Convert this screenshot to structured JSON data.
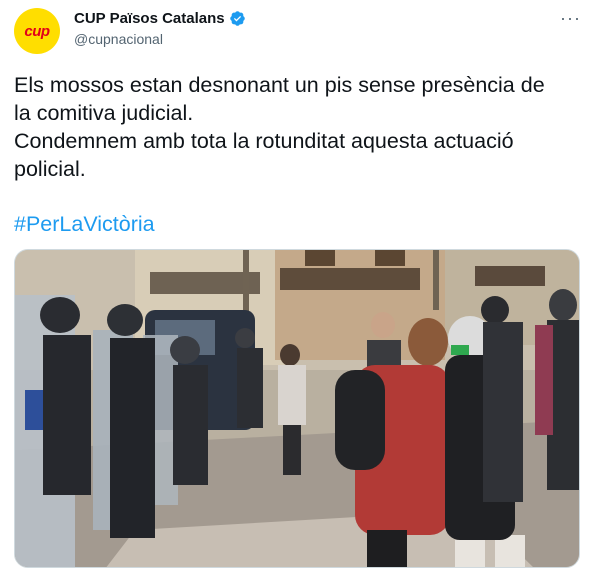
{
  "account": {
    "avatar_text": "cup",
    "display_name": "CUP Països Catalans",
    "handle": "@cupnacional",
    "verified": true,
    "avatar_color": "#ffde00",
    "avatar_text_color": "#e2001a"
  },
  "menu": {
    "more_label": "···",
    "icon": "more-icon"
  },
  "tweet": {
    "lines": [
      "Els mossos estan desnonant un pis sense presència de",
      "la comitiva judicial.",
      "Condemnem amb tota la rotunditat aquesta actuació",
      "policial."
    ],
    "hashtag": "#PerLaVictòria"
  },
  "colors": {
    "link": "#1d9bf0",
    "text": "#0f1419",
    "secondary": "#536471",
    "verified": "#1d9bf0"
  }
}
